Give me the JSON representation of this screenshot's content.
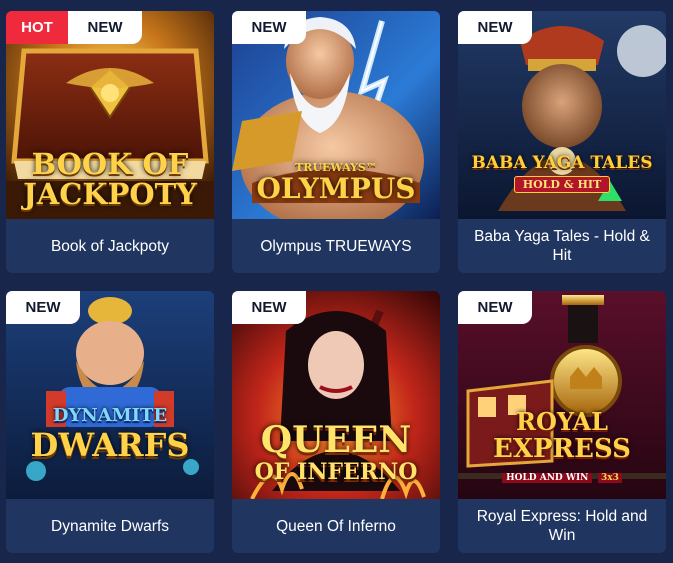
{
  "colors": {
    "page_background": "#17264a",
    "card_background": "#213561",
    "hot_badge": "#ef2a3c",
    "new_badge": "#ffffff",
    "caption_text": "#ffffff"
  },
  "games": [
    {
      "title": "Book of Jackpoty",
      "badges": [
        "HOT",
        "NEW"
      ],
      "art_text": [
        "BOOK OF",
        "JACKPOTY"
      ]
    },
    {
      "title": "Olympus TRUEWAYS",
      "badges": [
        "NEW"
      ],
      "art_text": [
        "TRUEWAYS™",
        "OLYMPUS"
      ]
    },
    {
      "title": "Baba Yaga Tales - Hold & Hit",
      "badges": [
        "NEW"
      ],
      "art_text": [
        "BABA YAGA TALES",
        "HOLD & HIT"
      ]
    },
    {
      "title": "Dynamite Dwarfs",
      "badges": [
        "NEW"
      ],
      "art_text": [
        "DYNAMITE",
        "DWARFS"
      ]
    },
    {
      "title": "Queen Of Inferno",
      "badges": [
        "NEW"
      ],
      "art_text": [
        "QUEEN",
        "OF INFERNO"
      ]
    },
    {
      "title": "Royal Express: Hold and Win",
      "badges": [
        "NEW"
      ],
      "art_text": [
        "ROYAL",
        "EXPRESS",
        "HOLD AND WIN",
        "3x3"
      ]
    }
  ]
}
